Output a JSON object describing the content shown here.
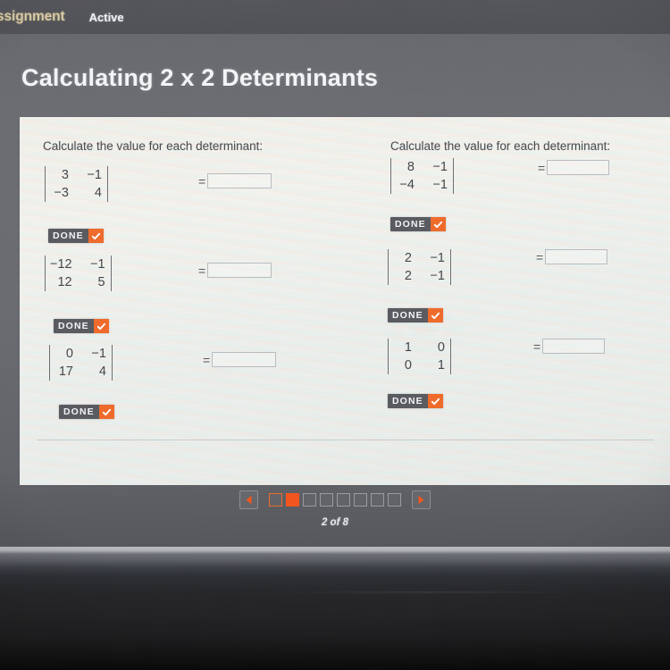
{
  "nav": {
    "assignment_label": "ssignment",
    "status_label": "Active"
  },
  "header": {
    "title": "Calculating 2 x 2 Determinants"
  },
  "columns": {
    "left": {
      "prompt": "Calculate the value for each determinant:",
      "problems": [
        {
          "matrix": [
            [
              "3",
              "−1"
            ],
            [
              "−3",
              "4"
            ]
          ],
          "equals": "=",
          "answer": "",
          "done_label": "DONE"
        },
        {
          "matrix": [
            [
              "−12",
              "−1"
            ],
            [
              "12",
              "5"
            ]
          ],
          "equals": "=",
          "answer": "",
          "done_label": "DONE"
        },
        {
          "matrix": [
            [
              "0",
              "−1"
            ],
            [
              "17",
              "4"
            ]
          ],
          "equals": "=",
          "answer": "",
          "done_label": "DONE"
        }
      ]
    },
    "right": {
      "prompt": "Calculate the value for each determinant:",
      "problems": [
        {
          "matrix": [
            [
              "8",
              "−1"
            ],
            [
              "−4",
              "−1"
            ]
          ],
          "equals": "=",
          "answer": "",
          "done_label": "DONE"
        },
        {
          "matrix": [
            [
              "2",
              "−1"
            ],
            [
              "2",
              "−1"
            ]
          ],
          "equals": "=",
          "answer": "",
          "done_label": "DONE"
        },
        {
          "matrix": [
            [
              "1",
              "0"
            ],
            [
              "0",
              "1"
            ]
          ],
          "equals": "=",
          "answer": "",
          "done_label": "DONE"
        }
      ]
    }
  },
  "pager": {
    "prev_icon": "triangle-left-icon",
    "next_icon": "triangle-right-icon",
    "total_steps": 8,
    "current_step": 2,
    "count_label": "2 of 8"
  },
  "colors": {
    "accent_orange": "#f4551f",
    "done_orange": "#ef6b2b",
    "nav_assignment": "#d9cba6",
    "card_background": "#f1f0ec",
    "app_background": "#6a6c72"
  }
}
